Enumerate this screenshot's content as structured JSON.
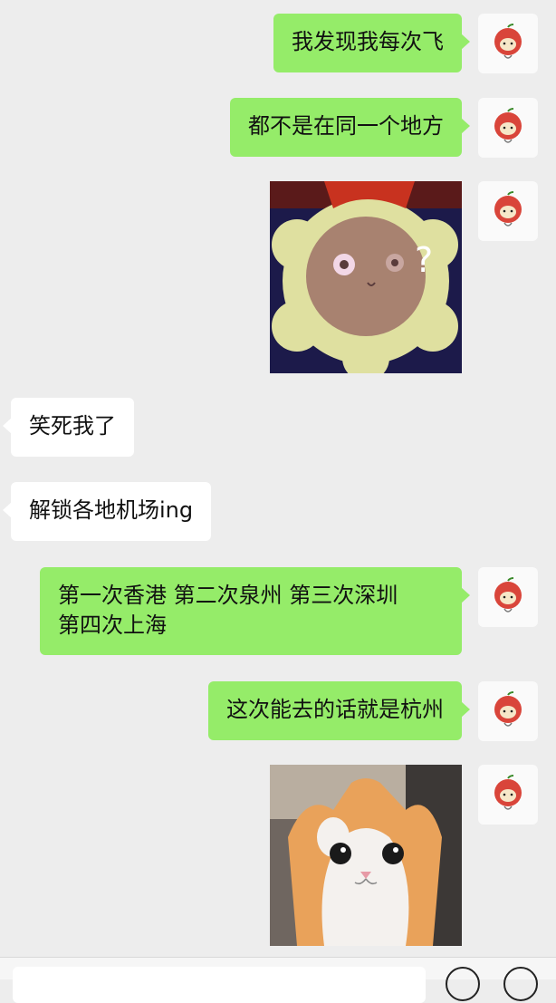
{
  "messages": [
    {
      "side": "me",
      "type": "text",
      "text": "我发现我每次飞"
    },
    {
      "side": "me",
      "type": "text",
      "text": "都不是在同一个地方"
    },
    {
      "side": "me",
      "type": "sticker",
      "sticker": "sunflower-question",
      "glyph": "?"
    },
    {
      "side": "other",
      "type": "text",
      "text": "笑死我了"
    },
    {
      "side": "other",
      "type": "text",
      "text": "解锁各地机场ing"
    },
    {
      "side": "me",
      "type": "text",
      "lines": [
        "第一次香港 第二次泉州 第三次深圳",
        "第四次上海"
      ]
    },
    {
      "side": "me",
      "type": "text",
      "text": "这次能去的话就是杭州"
    },
    {
      "side": "me",
      "type": "sticker",
      "sticker": "cat-selfie"
    }
  ],
  "avatar_icon": "apple-cat-icon",
  "colors": {
    "me_bubble": "#95ec69",
    "other_bubble": "#ffffff",
    "background": "#ededed"
  }
}
